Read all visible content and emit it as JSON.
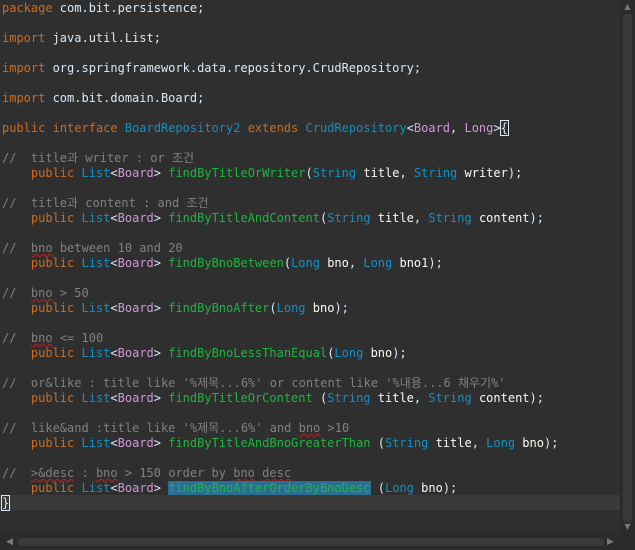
{
  "code": {
    "l01": {
      "kw": "package",
      "rest": " com.bit.persistence;"
    },
    "l02": {
      "kw": "import",
      "rest": " java.util.List;"
    },
    "l03": {
      "kw": "import",
      "rest": " org.springframework.data.repository.CrudRepository;"
    },
    "l04": {
      "kw": "import",
      "rest": " com.bit.domain.Board;"
    },
    "l05": {
      "kw1": "public",
      "kw2": "interface",
      "name": "BoardRepository2",
      "kw3": "extends",
      "type": "CrudRepository",
      "lt": "<",
      "g1": "Board",
      "comma": ", ",
      "g2": "Long",
      "gt": ">",
      "brace": "{"
    },
    "c1": "//  title과 writer : or 조건",
    "m1": {
      "pub": "public",
      "list": "List",
      "lt": "<",
      "g": "Board",
      "gt": ">",
      "name": "findByTitleOrWriter",
      "open": "(",
      "t1": "String",
      "a1": "title",
      "sep": ", ",
      "t2": "String",
      "a2": "writer",
      "close": ");"
    },
    "c2": "//  title과 content : and 조건",
    "m2": {
      "pub": "public",
      "list": "List",
      "lt": "<",
      "g": "Board",
      "gt": ">",
      "name": "findByTitleAndContent",
      "open": "(",
      "t1": "String",
      "a1": "title",
      "sep": ", ",
      "t2": "String",
      "a2": "content",
      "close": ");"
    },
    "c3a": "//  ",
    "c3b": "bno",
    "c3c": " between 10 and 20",
    "m3": {
      "pub": "public",
      "list": "List",
      "lt": "<",
      "g": "Board",
      "gt": ">",
      "name": "findByBnoBetween",
      "open": "(",
      "t1": "Long",
      "a1": "bno",
      "sep": ", ",
      "t2": "Long",
      "a2": "bno1",
      "close": ");"
    },
    "c4a": "//  ",
    "c4b": "bno",
    "c4c": " > 50",
    "m4": {
      "pub": "public",
      "list": "List",
      "lt": "<",
      "g": "Board",
      "gt": ">",
      "name": "findByBnoAfter",
      "open": "(",
      "t1": "Long",
      "a1": "bno",
      "close": ");"
    },
    "c5a": "//  ",
    "c5b": "bno",
    "c5c": " <= 100",
    "m5": {
      "pub": "public",
      "list": "List",
      "lt": "<",
      "g": "Board",
      "gt": ">",
      "name": "findByBnoLessThanEqual",
      "open": "(",
      "t1": "Long",
      "a1": "bno",
      "close": ");"
    },
    "c6": "//  or&like : title like '%제목...6%' or content like '%내용...6 채우기%'",
    "m6": {
      "pub": "public",
      "list": "List",
      "lt": "<",
      "g": "Board",
      "gt": ">",
      "name": "findByTitleOrContent",
      "open": " (",
      "t1": "String",
      "a1": "title",
      "sep": ", ",
      "t2": "String",
      "a2": "content",
      "close": ");"
    },
    "c7a": "//  like&and :title like '%제목...6%' and ",
    "c7b": "bno",
    "c7c": " >10",
    "m7": {
      "pub": "public",
      "list": "List",
      "lt": "<",
      "g": "Board",
      "gt": ">",
      "name": "findByTitleAndBnoGreaterThan",
      "open": " (",
      "t1": "String",
      "a1": "title",
      "sep": ", ",
      "t2": "Long",
      "a2": "bno",
      "close": ");"
    },
    "c8a": "//  ",
    "c8b": ">&desc",
    "c8c": " : ",
    "c8d": "bno",
    "c8e": " > 150 order by ",
    "c8f": "bno",
    "c8g": " ",
    "c8h": "desc",
    "m8": {
      "pub": "public",
      "list": "List",
      "lt": "<",
      "g": "Board",
      "gt": ">",
      "name": "findByBnoAfterOrderByBnoDesc",
      "open": " (",
      "t1": "Long",
      "a1": "bno",
      "close": ");"
    },
    "end": "}"
  },
  "scrollbars": {
    "up": "▲",
    "down": "▼",
    "left": "◀",
    "right": "▶"
  }
}
